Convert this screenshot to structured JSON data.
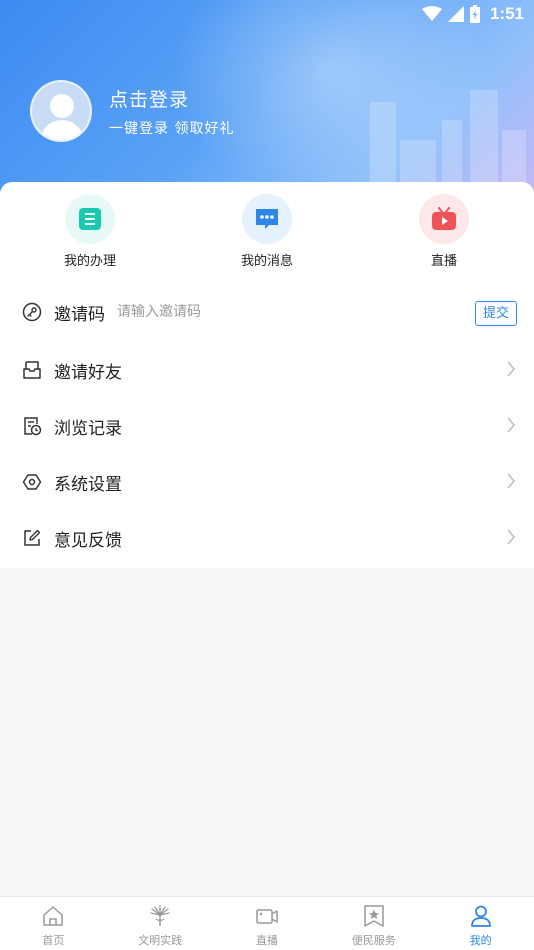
{
  "status_bar": {
    "time": "1:51"
  },
  "profile": {
    "login_title": "点击登录",
    "login_subtitle": "一键登录  领取好礼"
  },
  "quick_actions": [
    {
      "label": "我的办理",
      "icon": "document-icon",
      "color": "#17c9b0",
      "bg": "#e6f9f6"
    },
    {
      "label": "我的消息",
      "icon": "message-icon",
      "color": "#2f86e8",
      "bg": "#e5f1fd"
    },
    {
      "label": "直播",
      "icon": "tv-play-icon",
      "color": "#f0525a",
      "bg": "#fde8e9"
    }
  ],
  "invite": {
    "label": "邀请码",
    "placeholder": "请输入邀请码",
    "submit_label": "提交"
  },
  "menu": [
    {
      "label": "邀请好友",
      "icon": "inbox-icon"
    },
    {
      "label": "浏览记录",
      "icon": "history-icon"
    },
    {
      "label": "系统设置",
      "icon": "settings-hexagon-icon"
    },
    {
      "label": "意见反馈",
      "icon": "edit-icon"
    }
  ],
  "tabbar": [
    {
      "label": "首页",
      "icon": "home-icon",
      "active": false
    },
    {
      "label": "文明实践",
      "icon": "torch-icon",
      "active": false
    },
    {
      "label": "直播",
      "icon": "video-camera-icon",
      "active": false
    },
    {
      "label": "便民服务",
      "icon": "star-bookmark-icon",
      "active": false
    },
    {
      "label": "我的",
      "icon": "user-icon",
      "active": true
    }
  ],
  "colors": {
    "accent": "#2f86e8",
    "inactive": "#999999"
  }
}
